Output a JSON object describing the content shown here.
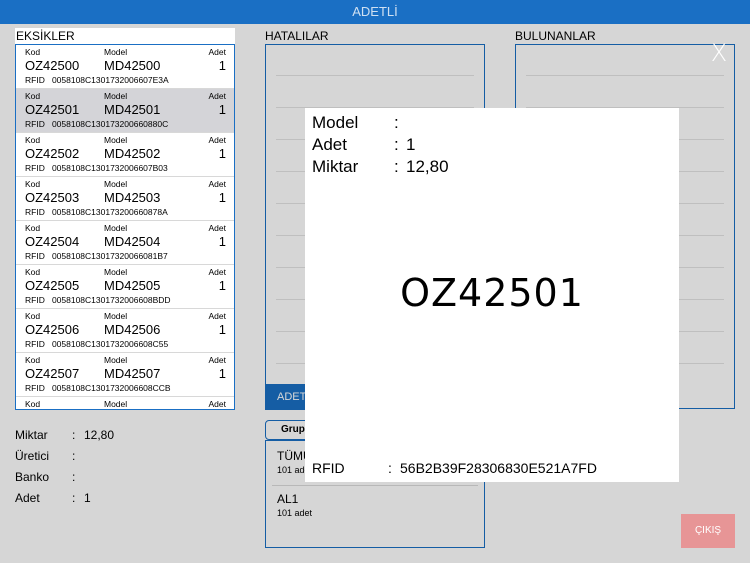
{
  "header": {
    "title": "ADETLİ"
  },
  "eksikler": {
    "title": "EKSİKLER",
    "labels": {
      "kod": "Kod",
      "model": "Model",
      "adet": "Adet",
      "rfid": "RFID"
    },
    "rows": [
      {
        "kod": "OZ42500",
        "model": "MD42500",
        "adet": "1",
        "rfid": "0058108C1301732006607E3A"
      },
      {
        "kod": "OZ42501",
        "model": "MD42501",
        "adet": "1",
        "rfid": "0058108C130173200660880C"
      },
      {
        "kod": "OZ42502",
        "model": "MD42502",
        "adet": "1",
        "rfid": "0058108C1301732006607B03"
      },
      {
        "kod": "OZ42503",
        "model": "MD42503",
        "adet": "1",
        "rfid": "0058108C130173200660878A"
      },
      {
        "kod": "OZ42504",
        "model": "MD42504",
        "adet": "1",
        "rfid": "0058108C13017320066081B7"
      },
      {
        "kod": "OZ42505",
        "model": "MD42505",
        "adet": "1",
        "rfid": "0058108C1301732006608BDD"
      },
      {
        "kod": "OZ42506",
        "model": "MD42506",
        "adet": "1",
        "rfid": "0058108C1301732006608C55"
      },
      {
        "kod": "OZ42507",
        "model": "MD42507",
        "adet": "1",
        "rfid": "0058108C1301732006608CCB"
      }
    ]
  },
  "hatalilar": {
    "title": "HATALILAR",
    "adet_button": "ADET"
  },
  "bulunanlar": {
    "title": "BULUNANLAR"
  },
  "groups": {
    "tab": "Grup",
    "items": [
      {
        "name": "TÜMÜ",
        "count": "101 adet"
      },
      {
        "name": "AL1",
        "count": "101 adet"
      }
    ]
  },
  "info": {
    "miktar": {
      "label": "Miktar",
      "value": "12,80"
    },
    "uretici": {
      "label": "Üretici",
      "value": ""
    },
    "banko": {
      "label": "Banko",
      "value": ""
    },
    "adet": {
      "label": "Adet",
      "value": "1"
    }
  },
  "buttons": {
    "close": "X",
    "cikis": "ÇIKIŞ"
  },
  "popup": {
    "model_label": "Model",
    "model_value": "",
    "adet_label": "Adet",
    "adet_value": "1",
    "miktar_label": "Miktar",
    "miktar_value": "12,80",
    "code": "OZ42501",
    "rfid_label": "RFID",
    "rfid_value": "56B2B39F28306830E521A7FD"
  },
  "colors": {
    "accent": "#1a6fc4",
    "selected_row": "#d4d4d8",
    "cikis": "#e79596"
  }
}
